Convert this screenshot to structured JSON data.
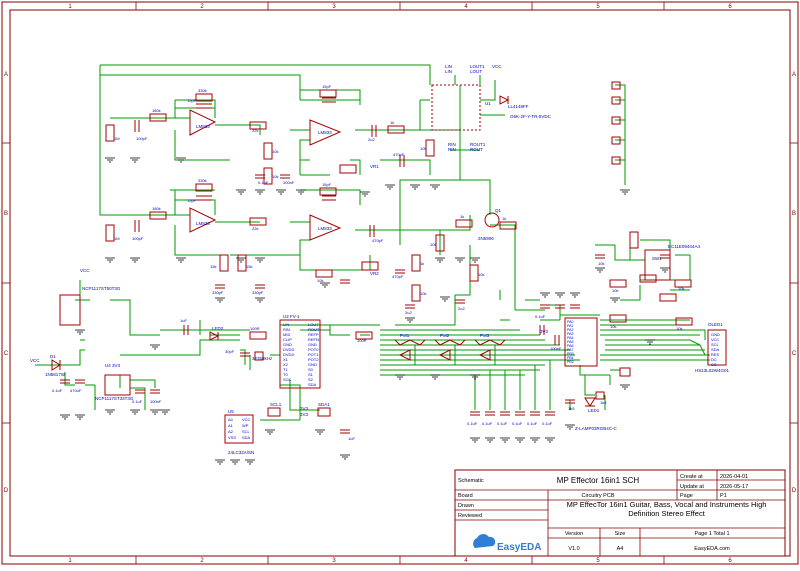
{
  "frame": {
    "cols_top": [
      "1",
      "2",
      "3",
      "4",
      "5",
      "6"
    ],
    "cols_bottom": [
      "1",
      "2",
      "3",
      "4",
      "5",
      "6"
    ],
    "rows_left": [
      "A",
      "B",
      "C",
      "D"
    ],
    "rows_right": [
      "A",
      "B",
      "C",
      "D"
    ]
  },
  "title_block": {
    "schematic_label": "Schematic",
    "schematic_title": "MP Effector 16in1 SCH",
    "create_label": "Create at",
    "create_date": "2026-04-01",
    "update_label": "Update at",
    "update_date": "2026-05-17",
    "board_label": "Board",
    "board_value": "Circuitry PCB",
    "page_label": "Page",
    "page_value": "P1",
    "drawn_label": "Drawn",
    "reviewed_label": "Reviewed",
    "description": "MP EffecTor 16in1 Guitar, Bass, Vocal and Instruments High Definition Stereo Effect",
    "version_label": "Version",
    "version_value": "V1.0",
    "size_label": "Size",
    "size_value": "A4",
    "page_total": "Page  1  Total  1",
    "brand": "EasyEDA",
    "site": "EasyEDA.com"
  },
  "labels": {
    "lin": "LIN",
    "rin": "RIN",
    "lout1": "LOUT1",
    "lout": "LOUT",
    "rout1": "ROUT1",
    "rout": "ROUT",
    "vcc": "VCC",
    "relay": "G6K-2F-Y-TR-5VDC",
    "relay_ref": "U1",
    "diode_d2": "LL4148FF",
    "ic_lm833_a": "LM833",
    "ic_lm833_b": "LM833",
    "ic_lm833_c": "LM833",
    "ic_lm833_d": "LM833",
    "vr1": "VR1",
    "vr2": "VR2",
    "q1": "Q1",
    "q1_part": "2N5906",
    "reg_top": "NCP1117ST50T3G",
    "reg_bottom": "NCP1117ST33T3G",
    "u43v3": "U4 3V3",
    "d1": "D1",
    "d1_part": "1N5817W",
    "enc": "EC11E09444A4",
    "sw1": "SW1",
    "oled": "OLED1",
    "oled_part": "HS13L02W4G01",
    "led2": "LED2",
    "led1": "LED1",
    "led1_part": "Z-LAMP03RGB4C-C",
    "fv1": "U2 FV-1",
    "eeprom": "24LC32A/SN",
    "u5": "U5",
    "pot1": "Pot1",
    "pot2": "Pot2",
    "pot3": "Pot3",
    "xtal": "32768kHz",
    "fv1_left_pins": [
      "LIN",
      "RIN",
      "MID",
      "CLIP",
      "GND",
      "DVDD",
      "DVDD",
      "X1",
      "X2",
      "T1",
      "T0",
      "SCK"
    ],
    "fv1_right_pins": [
      "LOUT",
      "ROUT",
      "REFP",
      "REFN",
      "GND",
      "POT0",
      "POT1",
      "POT2",
      "GND",
      "S0",
      "S1",
      "S2",
      "SDA"
    ],
    "eeprom_pins": [
      "A0",
      "A1",
      "A2",
      "VSS",
      "VCC",
      "WP",
      "SCL",
      "SDA"
    ],
    "mcu_pins": [
      "PA0",
      "PA1",
      "PA2",
      "PA3",
      "PA4",
      "PA5",
      "PA6",
      "PA7",
      "PB0",
      "PB1",
      "PB2"
    ],
    "oled_pins": [
      "GND",
      "VCC",
      "SCL",
      "SDA",
      "RES",
      "DC",
      "CS"
    ],
    "vin_label": "VIN",
    "gnd": "GND",
    "v33": "3V3",
    "net_scl1": "SCL1",
    "net_sda1": "SDA1",
    "part_330k": "330k",
    "part_15pf": "15pF",
    "part_180k": "180k",
    "part_1m": "1M",
    "part_100pf": "100pF",
    "part_22k": "22k",
    "part_10k": "10k",
    "part_470pf": "470pF",
    "part_1k": "1k",
    "part_2u2": "2u2",
    "part_100n": "100nF",
    "part_01uf": "0.1uF",
    "part_1uf": "1uF",
    "part_470uf": "470uF",
    "part_15k": "15k",
    "part_12k": "12k",
    "part_33k": "33k",
    "part_330pf": "330pF",
    "part_100r": "100R",
    "part_30pf": "30pF",
    "part_1k5": "1k5"
  },
  "colors": {
    "wire": "#009900",
    "part": "#a00000",
    "label": "#0000cc",
    "frame": "#880000",
    "gnd": "#000000"
  }
}
